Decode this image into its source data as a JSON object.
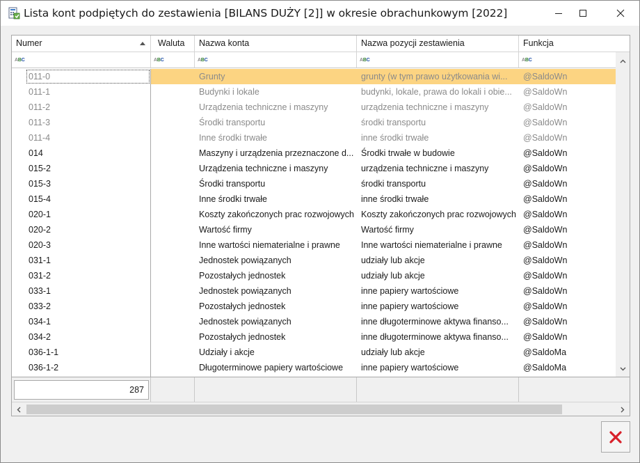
{
  "window": {
    "title": "Lista kont podpiętych do zestawienia [BILANS DUŻY [2]] w okresie obrachunkowym [2022]"
  },
  "icons": {
    "app": "calculator-list-icon",
    "minimize": "minimize-icon",
    "maximize": "maximize-icon",
    "close": "close-icon",
    "filter": "abc-filter-icon",
    "sort": "sort-asc-icon",
    "delete": "red-x-icon"
  },
  "colors": {
    "selected_row": "#fcd482",
    "inactive_text": "#8a8a8a",
    "close_x": "#d8202a"
  },
  "columns": {
    "numer": "Numer",
    "waluta": "Waluta",
    "nazwa_konta": "Nazwa konta",
    "nazwa_pozycji": "Nazwa pozycji zestawienia",
    "funkcja": "Funkcja"
  },
  "rows": [
    {
      "numer": "011-0",
      "waluta": "",
      "nazwa_konta": "Grunty",
      "nazwa_pozycji": "grunty (w tym prawo użytkowania wi...",
      "funkcja": "@SaldoWn",
      "inactive": true,
      "selected": true
    },
    {
      "numer": "011-1",
      "waluta": "",
      "nazwa_konta": "Budynki i lokale",
      "nazwa_pozycji": "budynki, lokale, prawa do lokali i obie...",
      "funkcja": "@SaldoWn",
      "inactive": true
    },
    {
      "numer": "011-2",
      "waluta": "",
      "nazwa_konta": "Urządzenia techniczne i maszyny",
      "nazwa_pozycji": "urządzenia techniczne i maszyny",
      "funkcja": "@SaldoWn",
      "inactive": true
    },
    {
      "numer": "011-3",
      "waluta": "",
      "nazwa_konta": "Środki transportu",
      "nazwa_pozycji": "środki transportu",
      "funkcja": "@SaldoWn",
      "inactive": true
    },
    {
      "numer": "011-4",
      "waluta": "",
      "nazwa_konta": "Inne środki trwałe",
      "nazwa_pozycji": "inne środki trwałe",
      "funkcja": "@SaldoWn",
      "inactive": true
    },
    {
      "numer": "014",
      "waluta": "",
      "nazwa_konta": "Maszyny i urządzenia przeznaczone d...",
      "nazwa_pozycji": "Środki trwałe w budowie",
      "funkcja": "@SaldoWn"
    },
    {
      "numer": "015-2",
      "waluta": "",
      "nazwa_konta": "Urządzenia techniczne i maszyny",
      "nazwa_pozycji": "urządzenia techniczne i maszyny",
      "funkcja": "@SaldoWn"
    },
    {
      "numer": "015-3",
      "waluta": "",
      "nazwa_konta": "Środki transportu",
      "nazwa_pozycji": "środki transportu",
      "funkcja": "@SaldoWn"
    },
    {
      "numer": "015-4",
      "waluta": "",
      "nazwa_konta": "Inne środki trwałe",
      "nazwa_pozycji": "inne środki trwałe",
      "funkcja": "@SaldoWn"
    },
    {
      "numer": "020-1",
      "waluta": "",
      "nazwa_konta": "Koszty zakończonych prac rozwojowych",
      "nazwa_pozycji": "Koszty zakończonych prac rozwojowych",
      "funkcja": "@SaldoWn"
    },
    {
      "numer": "020-2",
      "waluta": "",
      "nazwa_konta": "Wartość firmy",
      "nazwa_pozycji": "Wartość firmy",
      "funkcja": "@SaldoWn"
    },
    {
      "numer": "020-3",
      "waluta": "",
      "nazwa_konta": "Inne wartości niematerialne i prawne",
      "nazwa_pozycji": "Inne wartości niematerialne i prawne",
      "funkcja": "@SaldoWn"
    },
    {
      "numer": "031-1",
      "waluta": "",
      "nazwa_konta": "Jednostek powiązanych",
      "nazwa_pozycji": "udziały lub akcje",
      "funkcja": "@SaldoWn"
    },
    {
      "numer": "031-2",
      "waluta": "",
      "nazwa_konta": "Pozostałych jednostek",
      "nazwa_pozycji": "udziały lub akcje",
      "funkcja": "@SaldoWn"
    },
    {
      "numer": "033-1",
      "waluta": "",
      "nazwa_konta": "Jednostek powiązanych",
      "nazwa_pozycji": "inne papiery wartościowe",
      "funkcja": "@SaldoWn"
    },
    {
      "numer": "033-2",
      "waluta": "",
      "nazwa_konta": "Pozostałych jednostek",
      "nazwa_pozycji": "inne papiery wartościowe",
      "funkcja": "@SaldoWn"
    },
    {
      "numer": "034-1",
      "waluta": "",
      "nazwa_konta": "Jednostek powiązanych",
      "nazwa_pozycji": "inne długoterminowe aktywa finanso...",
      "funkcja": "@SaldoWn"
    },
    {
      "numer": "034-2",
      "waluta": "",
      "nazwa_konta": "Pozostałych jednostek",
      "nazwa_pozycji": "inne długoterminowe aktywa finanso...",
      "funkcja": "@SaldoWn"
    },
    {
      "numer": "036-1-1",
      "waluta": "",
      "nazwa_konta": "Udziały i akcje",
      "nazwa_pozycji": "udziały lub akcje",
      "funkcja": "@SaldoMa"
    },
    {
      "numer": "036-1-2",
      "waluta": "",
      "nazwa_konta": "Długoterminowe papiery wartościowe",
      "nazwa_pozycji": "inne papiery wartościowe",
      "funkcja": "@SaldoMa"
    }
  ],
  "footer": {
    "count": "287"
  }
}
